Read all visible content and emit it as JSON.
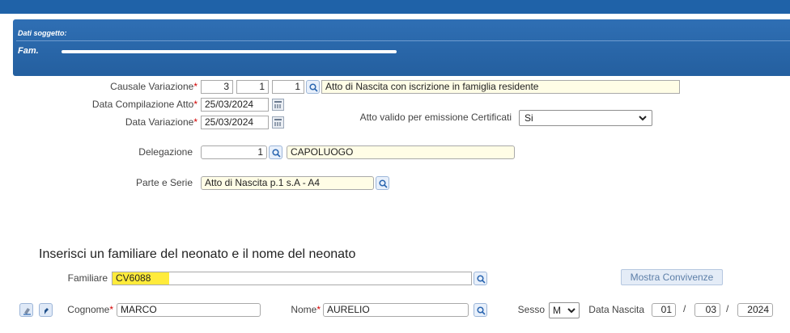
{
  "header": {
    "section_label": "Dati soggetto:",
    "fam_prefix": "Fam."
  },
  "form": {
    "causale": {
      "label": "Causale Variazione",
      "code1": "3",
      "code2": "1",
      "code3": "1",
      "description": "Atto di Nascita con iscrizione in famiglia residente"
    },
    "data_compilazione": {
      "label": "Data Compilazione Atto",
      "value": "25/03/2024"
    },
    "data_variazione": {
      "label": "Data Variazione",
      "value": "25/03/2024"
    },
    "atto_valido": {
      "label": "Atto valido per emissione Certificati",
      "value": "Si"
    },
    "delegazione": {
      "label": "Delegazione",
      "code": "1",
      "description": "CAPOLUOGO"
    },
    "parte_serie": {
      "label": "Parte e Serie",
      "value": "Atto di Nascita p.1 s.A - A4"
    }
  },
  "familiare_section": {
    "title": "Inserisci un familiare del neonato e il nome del neonato",
    "familiare_label": "Familiare",
    "familiare_value": "CV6088",
    "mostra_convivenze": "Mostra Convivenze",
    "cognome_label": "Cognome",
    "cognome_value": "MARCO",
    "nome_label": "Nome",
    "nome_value": "AURELIO",
    "sesso_label": "Sesso",
    "sesso_value": "M",
    "data_nascita_label": "Data Nascita",
    "dn_day": "01",
    "dn_month": "03",
    "dn_year": "2024",
    "date_sep": "/"
  },
  "required_mark": "*",
  "colors": {
    "header_blue": "#245f9f",
    "accent_yellow": "#ffeb3b",
    "field_yellow": "#fffde6",
    "required_red": "#d20000"
  },
  "icons": [
    "search-icon",
    "calendar-icon",
    "chevron-down-icon",
    "eraser-icon",
    "pointer-icon"
  ]
}
